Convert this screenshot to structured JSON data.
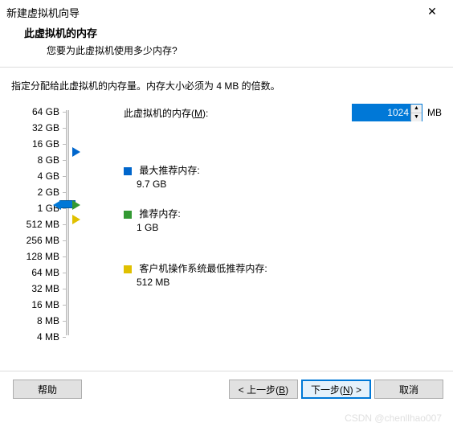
{
  "titlebar": {
    "title": "新建虚拟机向导",
    "close": "✕"
  },
  "header": {
    "title": "此虚拟机的内存",
    "subtitle": "您要为此虚拟机使用多少内存?"
  },
  "instruction": "指定分配给此虚拟机的内存量。内存大小必须为 4 MB 的倍数。",
  "memory": {
    "label_prefix": "此虚拟机的内存(",
    "label_accel": "M",
    "label_suffix": "):",
    "value": "1024",
    "unit": "MB"
  },
  "scale": {
    "labels": [
      "64 GB",
      "32 GB",
      "16 GB",
      "8 GB",
      "4 GB",
      "2 GB",
      "1 GB",
      "512 MB",
      "256 MB",
      "128 MB",
      "64 MB",
      "32 MB",
      "16 MB",
      "8 MB",
      "4 MB"
    ]
  },
  "legends": {
    "max": {
      "color": "#0066cc",
      "title": "最大推荐内存:",
      "value": "9.7 GB"
    },
    "rec": {
      "color": "#339933",
      "title": "推荐内存:",
      "value": "1 GB"
    },
    "min": {
      "color": "#e0c000",
      "title": "客户机操作系统最低推荐内存:",
      "value": "512 MB"
    }
  },
  "footer": {
    "help": "帮助",
    "back_prefix": "< 上一步(",
    "back_accel": "B",
    "back_suffix": ")",
    "next_prefix": "下一步(",
    "next_accel": "N",
    "next_suffix": ") >",
    "cancel": "取消"
  },
  "watermark": "CSDN @chenllhao007"
}
